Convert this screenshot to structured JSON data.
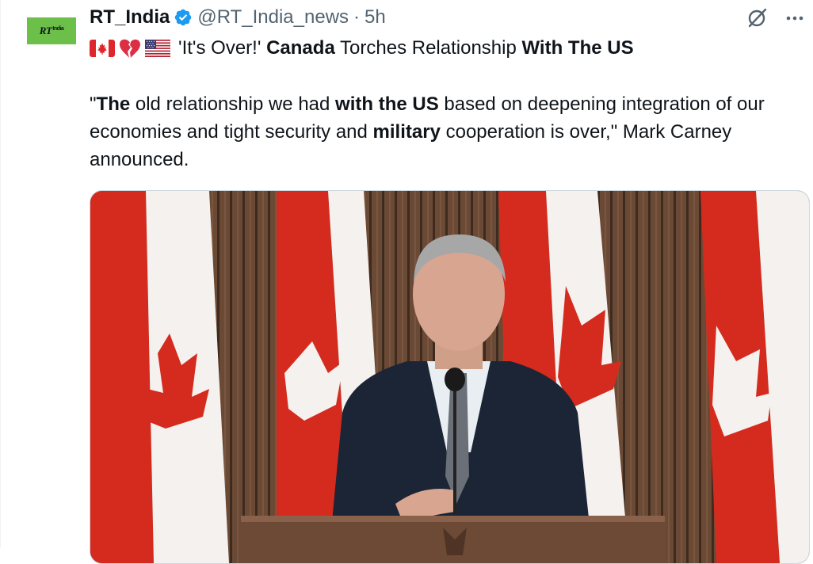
{
  "tweet": {
    "display_name": "RT_India",
    "handle": "@RT_India_news",
    "separator": "·",
    "time": "5h",
    "avatar_text": "RT",
    "avatar_sub": "India",
    "title_parts": [
      {
        "text": "'It's Over!' ",
        "bold": false
      },
      {
        "text": "Canada",
        "bold": true
      },
      {
        "text": " Torches Relationship ",
        "bold": false
      },
      {
        "text": "With The US",
        "bold": true
      }
    ],
    "body_parts": [
      {
        "text": "\"",
        "bold": false
      },
      {
        "text": "The",
        "bold": true
      },
      {
        "text": " old relationship we had ",
        "bold": false
      },
      {
        "text": "with the US",
        "bold": true
      },
      {
        "text": " based on deepening integration of our economies and tight security and ",
        "bold": false
      },
      {
        "text": "military",
        "bold": true
      },
      {
        "text": " cooperation is over,\" Mark Carney announced.",
        "bold": false
      }
    ]
  },
  "icons": {
    "verified": "verified-badge-icon",
    "grok": "grok-icon",
    "more": "more-icon",
    "flag_canada": "canada-flag-icon",
    "broken_heart": "broken-heart-icon",
    "flag_us": "us-flag-icon"
  },
  "colors": {
    "verified_blue": "#1d9bf0",
    "text": "#0f1419",
    "muted": "#536471",
    "avatar_green": "#6cc04a"
  }
}
